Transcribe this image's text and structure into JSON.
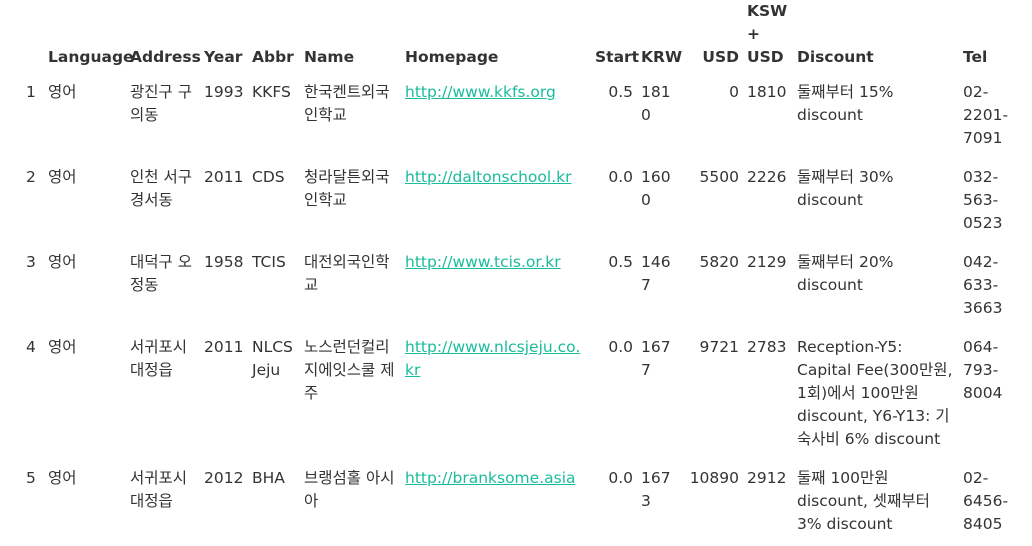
{
  "table": {
    "columns": [
      "Language",
      "Address",
      "Year",
      "Abbr",
      "Name",
      "Homepage",
      "Start",
      "KRW",
      "USD",
      "KSW + USD",
      "Discount",
      "Tel"
    ],
    "rows": [
      {
        "idx": "1",
        "language": "영어",
        "address": "광진구 구의동",
        "year": "1993",
        "abbr": "KKFS",
        "name": "한국켄트외국인학교",
        "homepage": "http://www.kkfs.org",
        "start": "0.5",
        "krw": "1810",
        "usd": "0",
        "ksw_usd": "1810",
        "discount": "둘째부터 15% discount",
        "tel": "02-2201-7091"
      },
      {
        "idx": "2",
        "language": "영어",
        "address": "인천 서구 경서동",
        "year": "2011",
        "abbr": "CDS",
        "name": "청라달튼외국인학교",
        "homepage": "http://daltonschool.kr",
        "start": "0.0",
        "krw": "1600",
        "usd": "5500",
        "ksw_usd": "2226",
        "discount": "둘째부터 30% discount",
        "tel": "032-563-0523"
      },
      {
        "idx": "3",
        "language": "영어",
        "address": "대덕구 오정동",
        "year": "1958",
        "abbr": "TCIS",
        "name": "대전외국인학교",
        "homepage": "http://www.tcis.or.kr",
        "start": "0.5",
        "krw": "1467",
        "usd": "5820",
        "ksw_usd": "2129",
        "discount": "둘째부터 20% discount",
        "tel": "042-633-3663"
      },
      {
        "idx": "4",
        "language": "영어",
        "address": "서귀포시 대정읍",
        "year": "2011",
        "abbr": "NLCS Jeju",
        "name": "노스런던컬리지에잇스쿨 제주",
        "homepage": "http://www.nlcsjeju.co.kr",
        "start": "0.0",
        "krw": "1677",
        "usd": "9721",
        "ksw_usd": "2783",
        "discount": "Reception-Y5: Capital Fee(300만원, 1회)에서 100만원 discount, Y6-Y13: 기숙사비 6% discount",
        "tel": "064-793-8004"
      },
      {
        "idx": "5",
        "language": "영어",
        "address": "서귀포시 대정읍",
        "year": "2012",
        "abbr": "BHA",
        "name": "브랭섬홀 아시아",
        "homepage": "http://branksome.asia",
        "start": "0.0",
        "krw": "1673",
        "usd": "10890",
        "ksw_usd": "2912",
        "discount": "둘째 100만원 discount, 셋째부터 3% discount",
        "tel": "02-6456-8405"
      }
    ]
  }
}
